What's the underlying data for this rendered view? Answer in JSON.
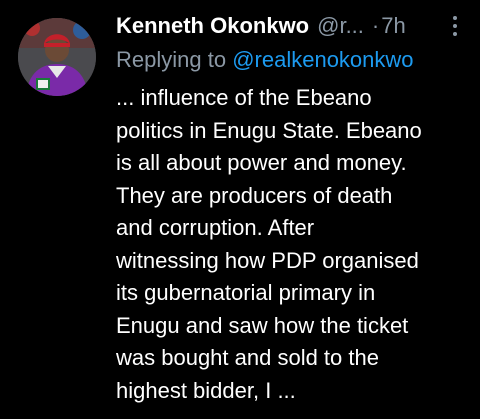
{
  "tweet": {
    "author_name": "Kenneth Okonkwo",
    "author_handle": "@r...",
    "separator": "·",
    "time": "7h",
    "reply_prefix": "Replying to",
    "reply_to": "@realkenokonkwo",
    "lines": [
      "... influence of the Ebeano",
      "politics in Enugu State. Ebeano",
      "is all about power and money.",
      "They are producers of death",
      "and corruption. After",
      "witnessing how PDP organised",
      "its gubernatorial primary in",
      "Enugu and saw how the ticket",
      "was bought and sold to the",
      "highest bidder, I ..."
    ]
  },
  "icons": {
    "more": "more-options-icon",
    "avatar": "profile-photo"
  },
  "colors": {
    "background": "#000000",
    "text": "#ffffff",
    "muted": "#8b98a5",
    "link": "#1d9bf0"
  }
}
